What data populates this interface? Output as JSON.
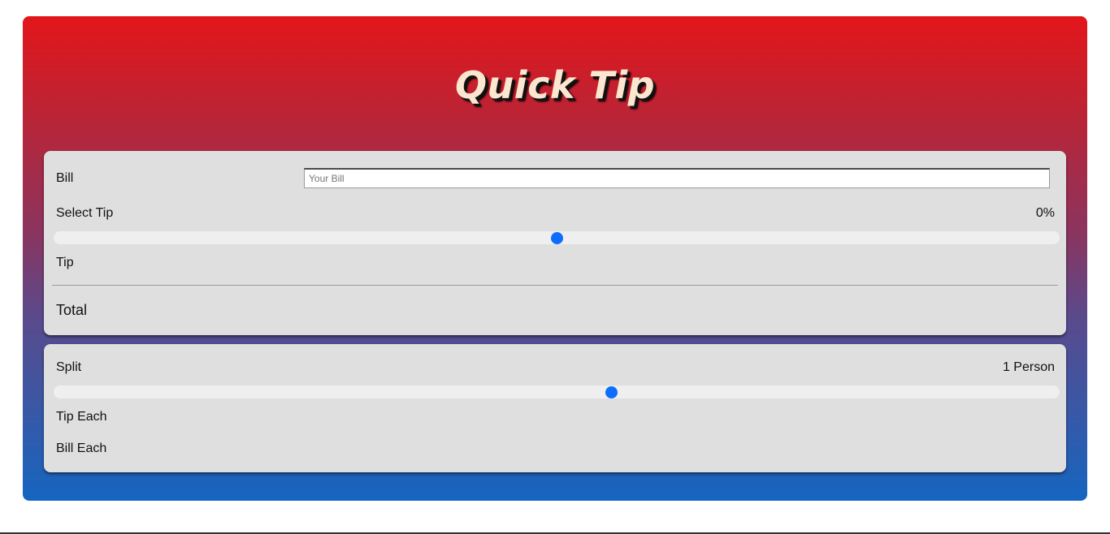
{
  "app": {
    "title": "Quick Tip",
    "colors": {
      "gradient_top": "#e3161a",
      "gradient_bottom": "#1565c0",
      "card_bg": "#dfdfdf",
      "accent": "#0d6efd",
      "title_color": "#fbe7cf"
    }
  },
  "calculator": {
    "bill_label": "Bill",
    "bill_value": "",
    "bill_placeholder": "Your Bill",
    "select_tip_label": "Select Tip",
    "tip_percent_display": "0%",
    "tip_slider_level": 0.5,
    "tip_label": "Tip",
    "tip_value": "",
    "total_label": "Total",
    "total_value": ""
  },
  "split": {
    "split_label": "Split",
    "split_display": "1 Person",
    "split_slider_level": 0.555,
    "tip_each_label": "Tip Each",
    "tip_each_value": "",
    "bill_each_label": "Bill Each",
    "bill_each_value": ""
  }
}
